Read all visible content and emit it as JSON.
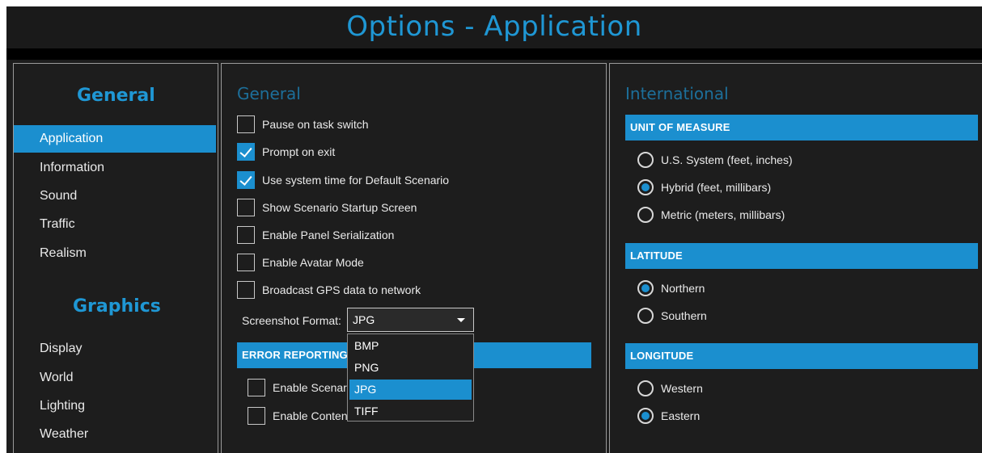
{
  "window": {
    "title": "Options - Application"
  },
  "sidebar": {
    "general_heading": "General",
    "general_items": [
      {
        "label": "Application",
        "active": true
      },
      {
        "label": "Information"
      },
      {
        "label": "Sound"
      },
      {
        "label": "Traffic"
      },
      {
        "label": "Realism"
      }
    ],
    "graphics_heading": "Graphics",
    "graphics_items": [
      {
        "label": "Display"
      },
      {
        "label": "World"
      },
      {
        "label": "Lighting"
      },
      {
        "label": "Weather"
      }
    ]
  },
  "general_panel": {
    "title": "General",
    "checkboxes": [
      {
        "label": "Pause on task switch",
        "checked": false
      },
      {
        "label": "Prompt on exit",
        "checked": true
      },
      {
        "label": "Use system time for Default Scenario",
        "checked": true
      },
      {
        "label": "Show Scenario Startup Screen",
        "checked": false
      },
      {
        "label": "Enable Panel Serialization",
        "checked": false
      },
      {
        "label": "Enable Avatar Mode",
        "checked": false
      },
      {
        "label": "Broadcast GPS data to network",
        "checked": false
      }
    ],
    "screenshot_format": {
      "label": "Screenshot Format:",
      "value": "JPG",
      "options": [
        "BMP",
        "PNG",
        "JPG",
        "TIFF"
      ]
    },
    "error_reporting": {
      "heading": "ERROR REPORTING",
      "checkboxes": [
        {
          "label": "Enable Scenari",
          "checked": false
        },
        {
          "label": "Enable Conten",
          "checked": false
        }
      ]
    }
  },
  "international_panel": {
    "title": "International",
    "unit_of_measure": {
      "heading": "UNIT OF MEASURE",
      "options": [
        {
          "label": "U.S. System (feet, inches)",
          "selected": false
        },
        {
          "label": "Hybrid (feet, millibars)",
          "selected": true
        },
        {
          "label": "Metric (meters, millibars)",
          "selected": false
        }
      ]
    },
    "latitude": {
      "heading": "LATITUDE",
      "options": [
        {
          "label": "Northern",
          "selected": true
        },
        {
          "label": "Southern",
          "selected": false
        }
      ]
    },
    "longitude": {
      "heading": "LONGITUDE",
      "options": [
        {
          "label": "Western",
          "selected": false
        },
        {
          "label": "Eastern",
          "selected": true
        }
      ]
    }
  },
  "colors": {
    "accent": "#1b8fcf",
    "title": "#1f97d4",
    "background": "#1d1d1d"
  }
}
